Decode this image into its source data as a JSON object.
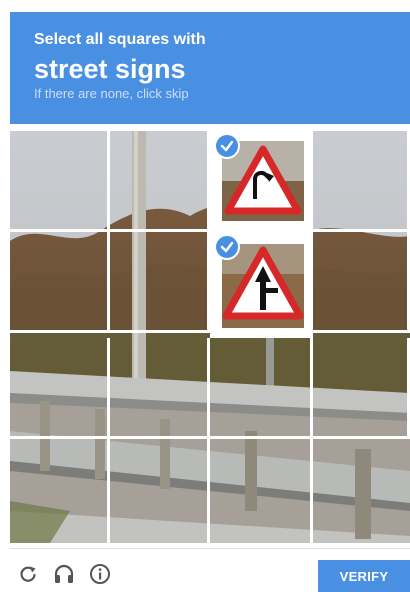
{
  "captcha": {
    "instruction": "Select all squares with",
    "target": "street signs",
    "hint": "If there are none, click skip"
  },
  "grid": {
    "rows": 4,
    "cols": 4,
    "selected_tiles": [
      2,
      6
    ]
  },
  "footer": {
    "verify_label": "VERIFY",
    "reload_icon": "reload-icon",
    "audio_icon": "headphones-icon",
    "info_icon": "info-icon"
  },
  "colors": {
    "accent": "#4a90e2",
    "sign_red": "#d62828"
  }
}
